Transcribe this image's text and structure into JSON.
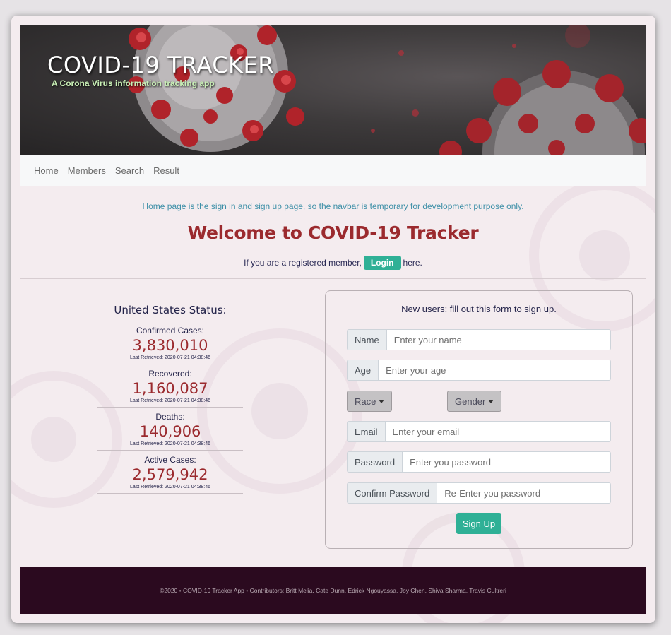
{
  "header": {
    "title": "COVID-19 TRACKER",
    "subtitle": "A Corona Virus information tracking app"
  },
  "nav": {
    "items": [
      {
        "label": "Home"
      },
      {
        "label": "Members"
      },
      {
        "label": "Search"
      },
      {
        "label": "Result"
      }
    ]
  },
  "main": {
    "dev_note": "Home page is the sign in and sign up page, so the navbar is temporary for development purpose only.",
    "welcome": "Welcome to COVID-19 Tracker",
    "login_prefix": "If you are a registered member,",
    "login_button": "Login",
    "login_suffix": "here."
  },
  "status": {
    "title": "United States Status:",
    "stats": [
      {
        "label": "Confirmed Cases:",
        "value": "3,830,010",
        "retrieved": "Last Retrieved: 2020-07-21 04:38:46"
      },
      {
        "label": "Recovered:",
        "value": "1,160,087",
        "retrieved": "Last Retrieved: 2020-07-21 04:38:46"
      },
      {
        "label": "Deaths:",
        "value": "140,906",
        "retrieved": "Last Retrieved: 2020-07-21 04:38:46"
      },
      {
        "label": "Active Cases:",
        "value": "2,579,942",
        "retrieved": "Last Retrieved: 2020-07-21 04:38:46"
      }
    ]
  },
  "form": {
    "intro": "New users: fill out this form to sign up.",
    "name": {
      "label": "Name",
      "placeholder": "Enter your name"
    },
    "age": {
      "label": "Age",
      "placeholder": "Enter your age"
    },
    "race_button": "Race",
    "gender_button": "Gender",
    "email": {
      "label": "Email",
      "placeholder": "Enter your email"
    },
    "password": {
      "label": "Password",
      "placeholder": "Enter you password"
    },
    "confirm": {
      "label": "Confirm Password",
      "placeholder": "Re-Enter you password"
    },
    "submit": "Sign Up"
  },
  "footer": {
    "text": "©2020 • COVID-19 Tracker App • Contributors: Britt Melia, Cate Dunn, Edrick Ngouyassa, Joy Chen, Shiva Sharma, Travis Cultreri"
  },
  "colors": {
    "accent": "#2fb096",
    "headline": "#9b2a2e",
    "footer_bg": "#2b0a1f"
  }
}
